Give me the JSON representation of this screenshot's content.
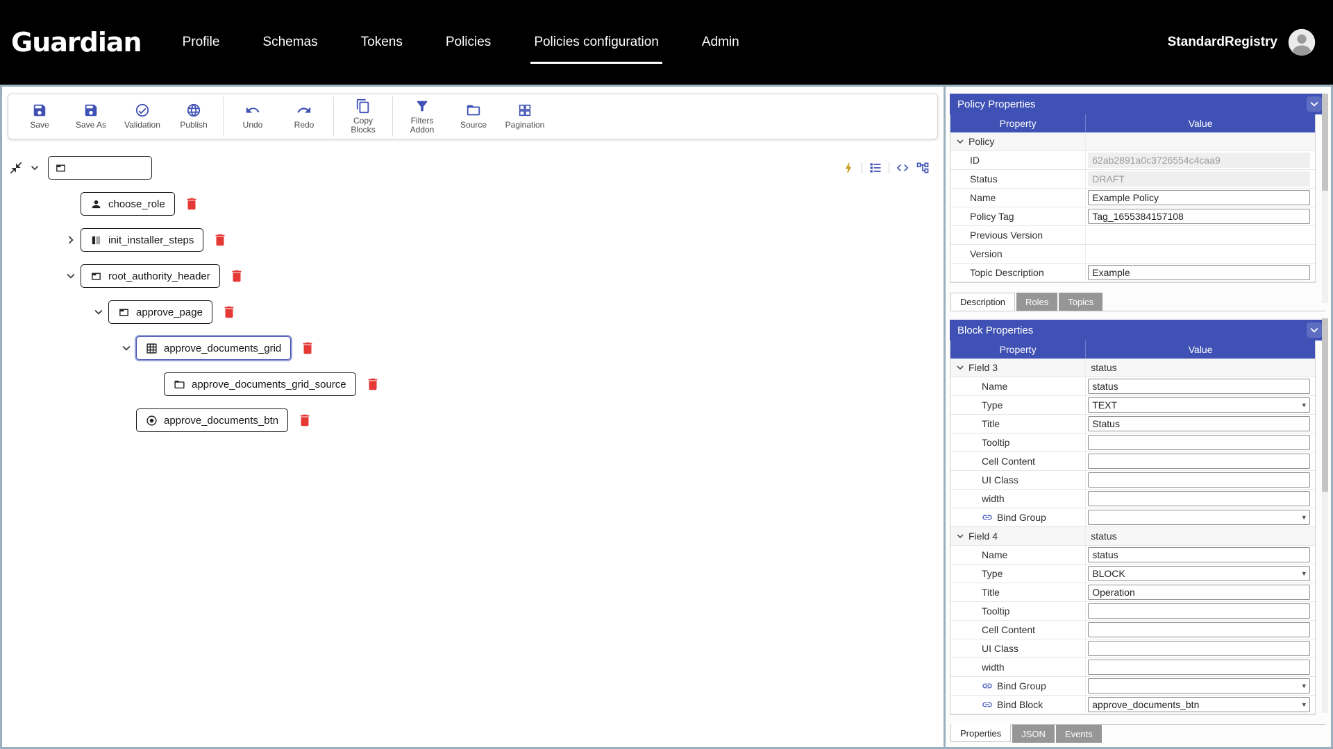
{
  "header": {
    "logo": "Guardian",
    "nav": [
      {
        "label": "Profile",
        "active": false
      },
      {
        "label": "Schemas",
        "active": false
      },
      {
        "label": "Tokens",
        "active": false
      },
      {
        "label": "Policies",
        "active": false
      },
      {
        "label": "Policies configuration",
        "active": true
      },
      {
        "label": "Admin",
        "active": false
      }
    ],
    "user_name": "StandardRegistry",
    "avatar_icon": "avatar-icon"
  },
  "toolbar": {
    "groups": [
      {
        "buttons": [
          {
            "label": "Save",
            "icon": "save-icon"
          },
          {
            "label": "Save As",
            "icon": "save-as-icon"
          },
          {
            "label": "Validation",
            "icon": "validation-icon"
          },
          {
            "label": "Publish",
            "icon": "publish-icon"
          }
        ]
      },
      {
        "buttons": [
          {
            "label": "Undo",
            "icon": "undo-icon"
          },
          {
            "label": "Redo",
            "icon": "redo-icon"
          }
        ]
      },
      {
        "buttons": [
          {
            "label": "Copy Blocks",
            "icon": "copy-blocks-icon"
          }
        ]
      },
      {
        "buttons": [
          {
            "label": "Filters Addon",
            "icon": "filters-addon-icon"
          },
          {
            "label": "Source",
            "icon": "source-folder-icon"
          },
          {
            "label": "Pagination",
            "icon": "pagination-icon"
          }
        ]
      }
    ]
  },
  "tree": {
    "root_label": "",
    "view_icons": [
      "events-bolt-icon",
      "blocks-list-icon",
      "code-view-icon",
      "tree-view-icon"
    ],
    "nodes": [
      {
        "label": "choose_role",
        "icon": "role-icon",
        "chevron": "",
        "depth": 0,
        "selected": false
      },
      {
        "label": "init_installer_steps",
        "icon": "steps-icon",
        "chevron": "right",
        "depth": 0,
        "selected": false
      },
      {
        "label": "root_authority_header",
        "icon": "container-icon",
        "chevron": "down",
        "depth": 0,
        "selected": false
      },
      {
        "label": "approve_page",
        "icon": "container-icon",
        "chevron": "down",
        "depth": 1,
        "selected": false
      },
      {
        "label": "approve_documents_grid",
        "icon": "grid-icon",
        "chevron": "down",
        "depth": 2,
        "selected": true
      },
      {
        "label": "approve_documents_grid_source",
        "icon": "source-folder-icon",
        "chevron": "",
        "depth": 3,
        "selected": false
      },
      {
        "label": "approve_documents_btn",
        "icon": "button-icon",
        "chevron": "",
        "depth": 2,
        "selected": false
      }
    ]
  },
  "policy_properties": {
    "title": "Policy Properties",
    "columns": [
      "Property",
      "Value"
    ],
    "groups": [
      {
        "label": "Policy",
        "value": "",
        "rows": [
          {
            "property": "ID",
            "value": "62ab2891a0c3726554c4caa9",
            "type": "readonly"
          },
          {
            "property": "Status",
            "value": "DRAFT",
            "type": "readonly"
          },
          {
            "property": "Name",
            "value": "Example Policy",
            "type": "input"
          },
          {
            "property": "Policy Tag",
            "value": "Tag_1655384157108",
            "type": "input"
          },
          {
            "property": "Previous Version",
            "value": "",
            "type": "empty"
          },
          {
            "property": "Version",
            "value": "",
            "type": "empty"
          },
          {
            "property": "Topic Description",
            "value": "Example",
            "type": "input"
          }
        ]
      }
    ],
    "tabs": [
      {
        "label": "Description",
        "active": true
      },
      {
        "label": "Roles",
        "active": false
      },
      {
        "label": "Topics",
        "active": false
      }
    ]
  },
  "block_properties": {
    "title": "Block Properties",
    "columns": [
      "Property",
      "Value"
    ],
    "groups": [
      {
        "label": "Field 3",
        "value": "status",
        "rows": [
          {
            "property": "Name",
            "value": "status",
            "type": "input"
          },
          {
            "property": "Type",
            "value": "TEXT",
            "type": "select"
          },
          {
            "property": "Title",
            "value": "Status",
            "type": "input"
          },
          {
            "property": "Tooltip",
            "value": "",
            "type": "input"
          },
          {
            "property": "Cell Content",
            "value": "",
            "type": "input"
          },
          {
            "property": "UI Class",
            "value": "",
            "type": "input"
          },
          {
            "property": "width",
            "value": "",
            "type": "input"
          },
          {
            "property": "Bind Group",
            "value": "",
            "type": "select",
            "icon": "link-icon"
          }
        ]
      },
      {
        "label": "Field 4",
        "value": "status",
        "rows": [
          {
            "property": "Name",
            "value": "status",
            "type": "input"
          },
          {
            "property": "Type",
            "value": "BLOCK",
            "type": "select"
          },
          {
            "property": "Title",
            "value": "Operation",
            "type": "input"
          },
          {
            "property": "Tooltip",
            "value": "",
            "type": "input"
          },
          {
            "property": "Cell Content",
            "value": "",
            "type": "input"
          },
          {
            "property": "UI Class",
            "value": "",
            "type": "input"
          },
          {
            "property": "width",
            "value": "",
            "type": "input"
          },
          {
            "property": "Bind Group",
            "value": "",
            "type": "select",
            "icon": "link-icon"
          },
          {
            "property": "Bind Block",
            "value": "approve_documents_btn",
            "type": "select",
            "icon": "link-icon"
          }
        ]
      }
    ],
    "tabs": [
      {
        "label": "Properties",
        "active": true
      },
      {
        "label": "JSON",
        "active": false
      },
      {
        "label": "Events",
        "active": false
      }
    ]
  },
  "colors": {
    "accent": "#3f51b5",
    "header_bg": "#000000",
    "danger": "#e53935",
    "bolt": "#c9a227",
    "frame": "#9ab0bf",
    "tab_inactive": "#969696"
  }
}
